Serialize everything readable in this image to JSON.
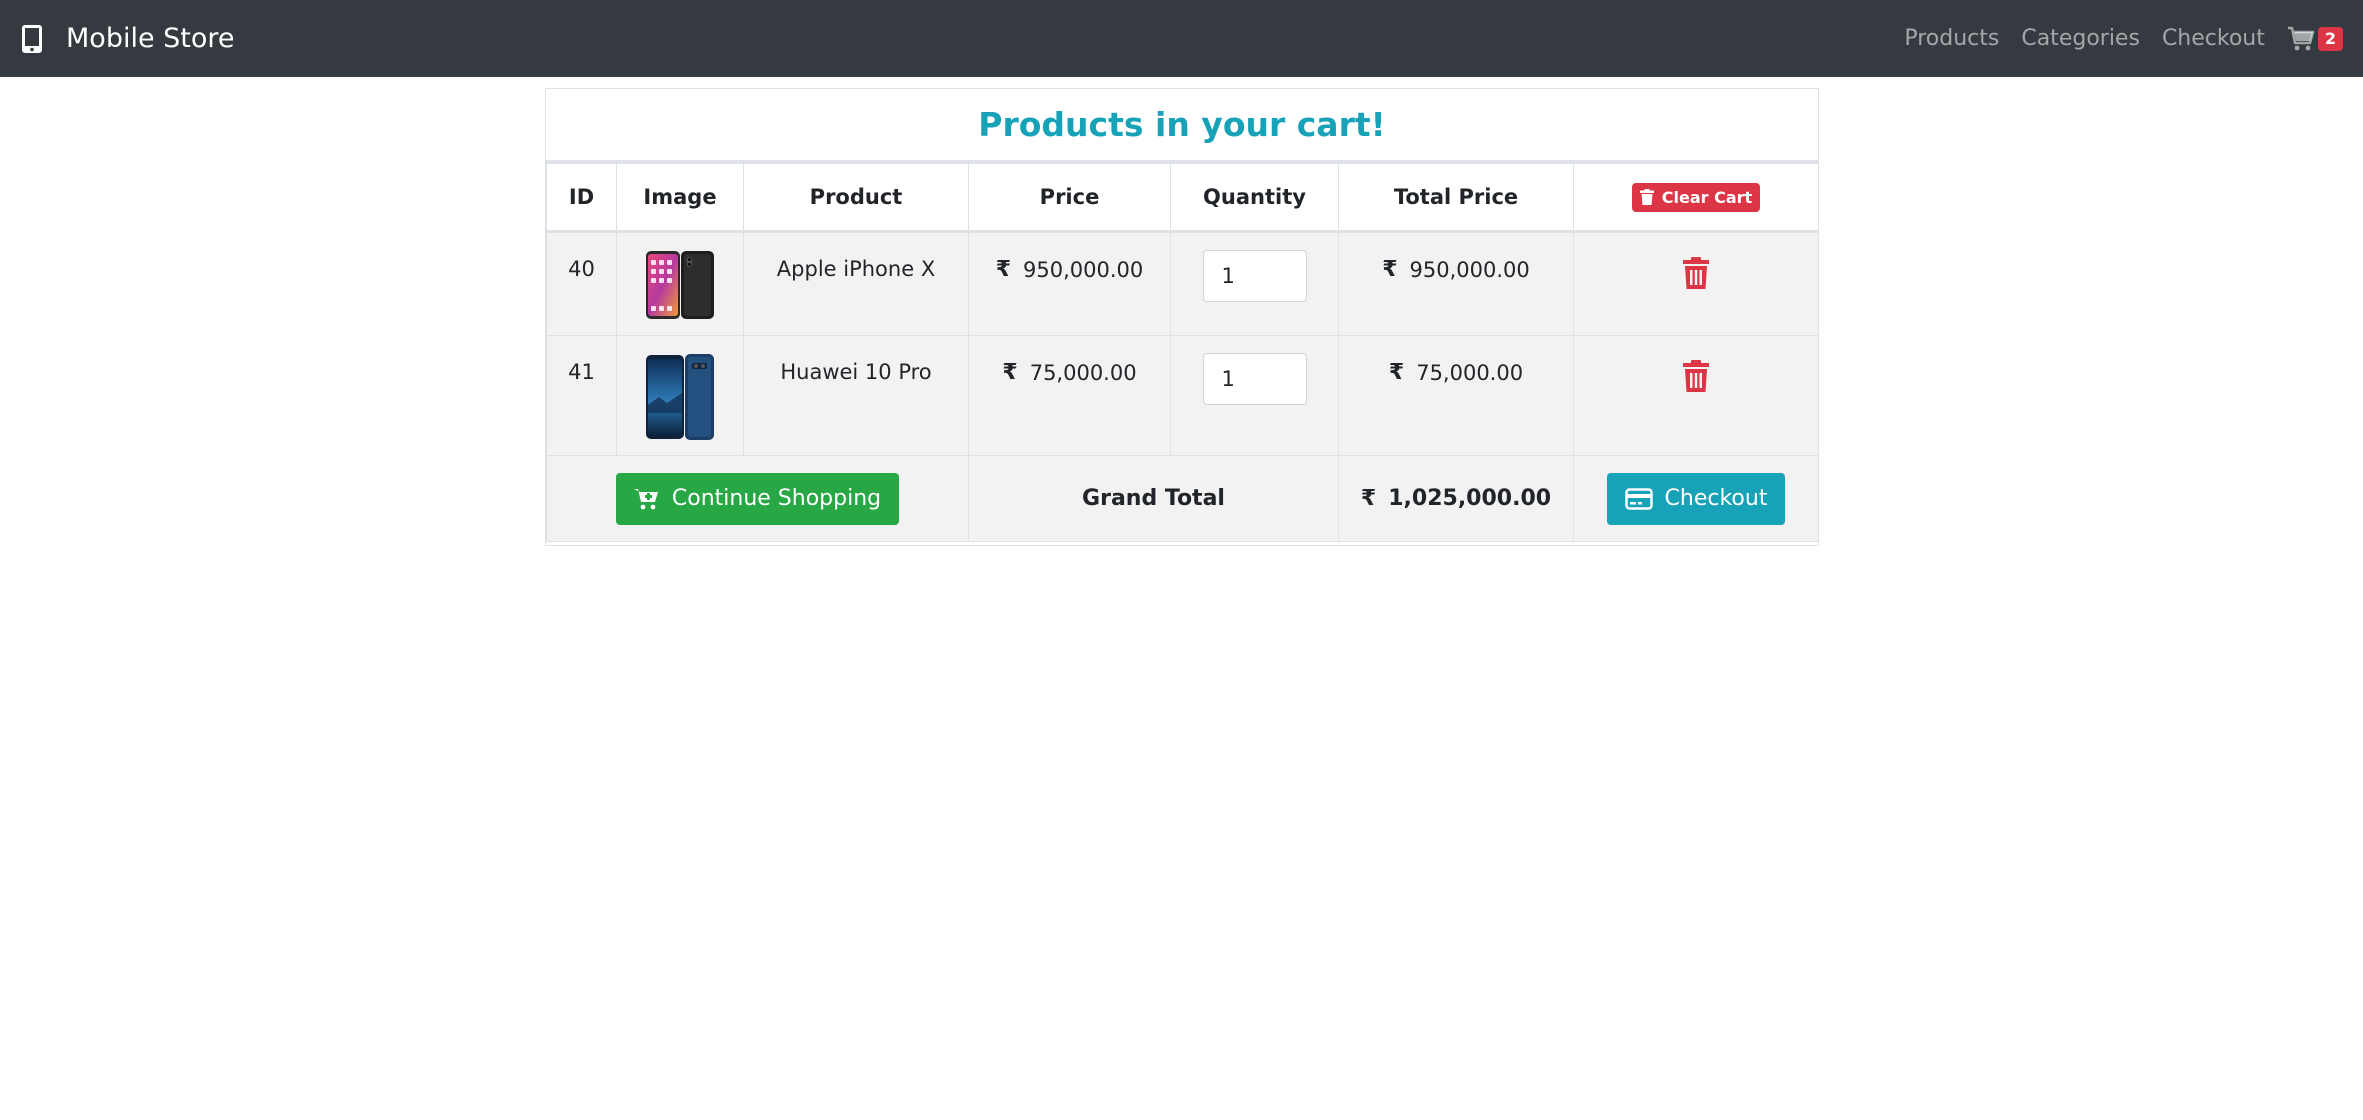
{
  "navbar": {
    "brand": "Mobile Store",
    "links": [
      "Products",
      "Categories",
      "Checkout"
    ],
    "cart_count": "2"
  },
  "card": {
    "title": "Products in your cart!"
  },
  "table": {
    "headers": {
      "id": "ID",
      "image": "Image",
      "product": "Product",
      "price": "Price",
      "quantity": "Quantity",
      "total_price": "Total Price"
    },
    "clear_cart_label": "Clear Cart",
    "currency_symbol": "₹",
    "rows": [
      {
        "id": "40",
        "product": "Apple iPhone X",
        "price": "950,000.00",
        "quantity": "1",
        "total": "950,000.00"
      },
      {
        "id": "41",
        "product": "Huawei 10 Pro",
        "price": "75,000.00",
        "quantity": "1",
        "total": "75,000.00"
      }
    ],
    "footer": {
      "continue_label": "Continue Shopping",
      "grand_total_label": "Grand Total",
      "grand_total_value": "1,025,000.00",
      "checkout_label": "Checkout"
    }
  },
  "colors": {
    "navbar_bg": "#343a40",
    "title": "#17a2b8",
    "danger": "#dc3545",
    "success": "#28a745",
    "info": "#17a2b8"
  }
}
